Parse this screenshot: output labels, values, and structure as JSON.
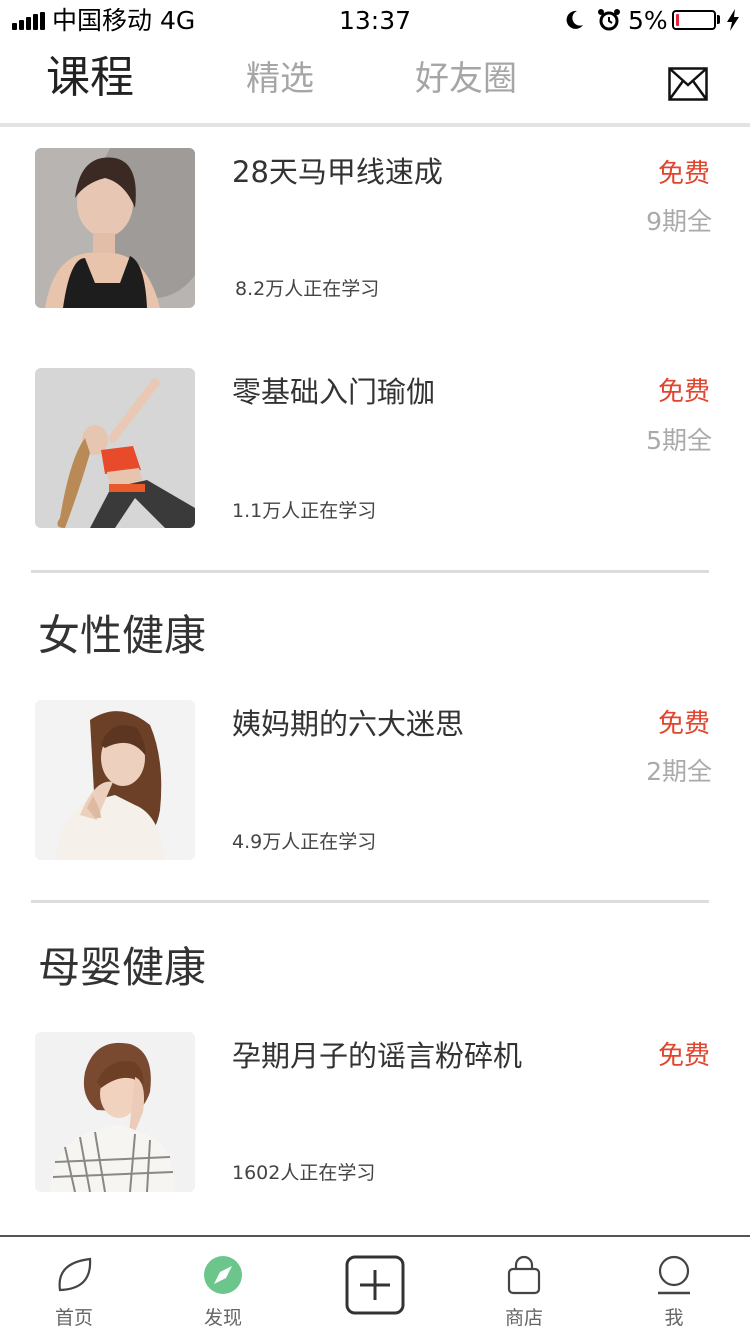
{
  "status_bar": {
    "carrier": "中国移动  4G",
    "time": "13:37",
    "battery": "5%"
  },
  "header": {
    "tabs": [
      {
        "label": "课程",
        "active": true
      },
      {
        "label": "精选",
        "active": false
      },
      {
        "label": "好友圈",
        "active": false
      }
    ],
    "mail_icon": "envelope-icon"
  },
  "courses": [
    {
      "title": "28天马甲线速成",
      "price": "免费",
      "episodes": "9期全",
      "learners": "8.2万人正在学习"
    },
    {
      "title": "零基础入门瑜伽",
      "price": "免费",
      "episodes": "5期全",
      "learners": "1.1万人正在学习"
    },
    {
      "title": "姨妈期的六大迷思",
      "price": "免费",
      "episodes": "2期全",
      "learners": "4.9万人正在学习"
    },
    {
      "title": "孕期月子的谣言粉碎机",
      "price": "免费",
      "episodes": "",
      "learners": "1602人正在学习"
    }
  ],
  "sections": {
    "womens_health": "女性健康",
    "maternal_health": "母婴健康"
  },
  "bottom_nav": [
    {
      "label": "首页",
      "icon": "leaf-icon"
    },
    {
      "label": "发现",
      "icon": "compass-icon",
      "active": true
    },
    {
      "label": "",
      "icon": "plus-square-icon"
    },
    {
      "label": "商店",
      "icon": "bag-icon"
    },
    {
      "label": "我",
      "icon": "user-icon"
    }
  ],
  "colors": {
    "price": "#e0452e",
    "active_nav": "#6cc68c"
  }
}
